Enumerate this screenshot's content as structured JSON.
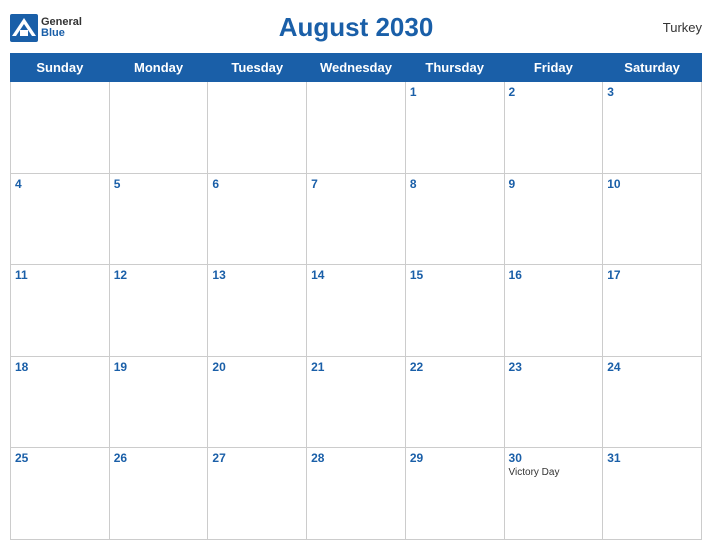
{
  "header": {
    "title": "August 2030",
    "country": "Turkey",
    "logo": {
      "general": "General",
      "blue": "Blue"
    }
  },
  "weekdays": [
    "Sunday",
    "Monday",
    "Tuesday",
    "Wednesday",
    "Thursday",
    "Friday",
    "Saturday"
  ],
  "weeks": [
    [
      {
        "day": null
      },
      {
        "day": null
      },
      {
        "day": null
      },
      {
        "day": null
      },
      {
        "day": 1
      },
      {
        "day": 2
      },
      {
        "day": 3
      }
    ],
    [
      {
        "day": 4
      },
      {
        "day": 5
      },
      {
        "day": 6
      },
      {
        "day": 7
      },
      {
        "day": 8
      },
      {
        "day": 9
      },
      {
        "day": 10
      }
    ],
    [
      {
        "day": 11
      },
      {
        "day": 12
      },
      {
        "day": 13
      },
      {
        "day": 14
      },
      {
        "day": 15
      },
      {
        "day": 16
      },
      {
        "day": 17
      }
    ],
    [
      {
        "day": 18
      },
      {
        "day": 19
      },
      {
        "day": 20
      },
      {
        "day": 21
      },
      {
        "day": 22
      },
      {
        "day": 23
      },
      {
        "day": 24
      }
    ],
    [
      {
        "day": 25
      },
      {
        "day": 26
      },
      {
        "day": 27
      },
      {
        "day": 28
      },
      {
        "day": 29
      },
      {
        "day": 30,
        "event": "Victory Day"
      },
      {
        "day": 31
      }
    ]
  ]
}
